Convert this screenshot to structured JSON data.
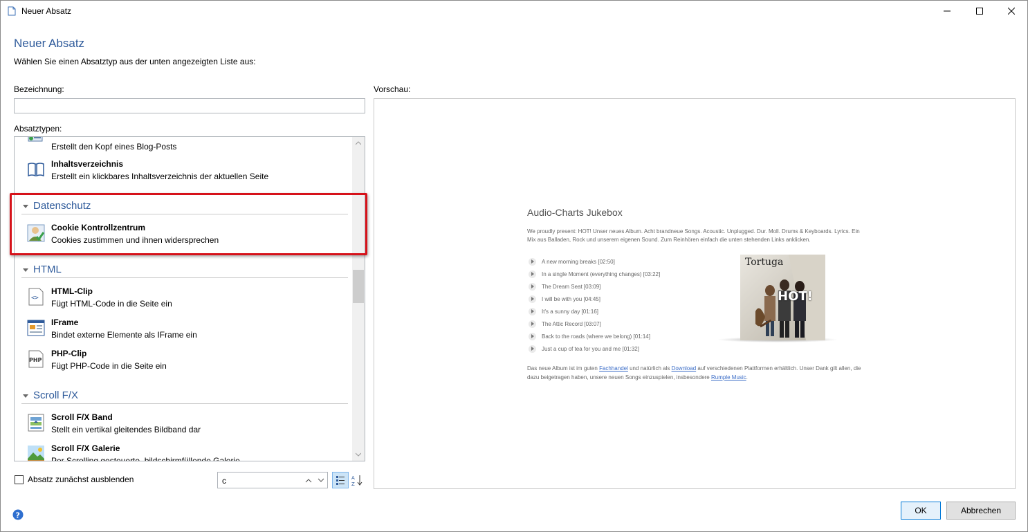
{
  "window": {
    "title": "Neuer Absatz",
    "icon": "document-icon",
    "controls": [
      "minimize",
      "maximize",
      "close"
    ]
  },
  "header": {
    "title": "Neuer Absatz",
    "subtitle": "Wählen Sie einen Absatztyp aus der unten angezeigten Liste aus:"
  },
  "form": {
    "name_label": "Bezeichnung:",
    "name_value": "",
    "types_label": "Absatztypen:",
    "preview_label": "Vorschau:"
  },
  "list": {
    "items_top": [
      {
        "name": "",
        "desc": "Erstellt den Kopf eines Blog-Posts",
        "icon": "blog-header-icon"
      },
      {
        "name": "Inhaltsverzeichnis",
        "desc": "Erstellt ein klickbares Inhaltsverzeichnis der aktuellen Seite",
        "icon": "book-icon"
      }
    ],
    "groups": [
      {
        "name": "Datenschutz",
        "items": [
          {
            "name": "Cookie Kontrollzentrum",
            "desc": "Cookies zustimmen und ihnen widersprechen",
            "icon": "user-check-icon"
          }
        ]
      },
      {
        "name": "HTML",
        "items": [
          {
            "name": "HTML-Clip",
            "desc": "Fügt HTML-Code in die Seite ein",
            "icon": "html-code-icon"
          },
          {
            "name": "IFrame",
            "desc": "Bindet externe Elemente als IFrame ein",
            "icon": "iframe-icon"
          },
          {
            "name": "PHP-Clip",
            "desc": "Fügt PHP-Code in die Seite ein",
            "icon": "php-icon"
          }
        ]
      },
      {
        "name": "Scroll F/X",
        "items": [
          {
            "name": "Scroll F/X Band",
            "desc": "Stellt ein vertikal gleitendes Bildband dar",
            "icon": "scroll-band-icon"
          },
          {
            "name": "Scroll F/X Galerie",
            "desc": "Per Scrolling gesteuerte, bildschirmfüllende Galerie",
            "icon": "landscape-icon"
          }
        ]
      }
    ]
  },
  "bottom": {
    "hide_checkbox_label": "Absatz zunächst ausblenden",
    "hide_checked": false,
    "search_value": "c"
  },
  "preview": {
    "title": "Audio-Charts Jukebox",
    "intro": "We proudly present: HOT! Unser neues Album. Acht brandneue Songs. Acoustic. Unplugged. Dur. Moll. Drums & Keyboards. Lyrics. Ein Mix aus Balladen, Rock und unserem eigenen Sound. Zum Reinhören einfach die unten stehenden Links anklicken.",
    "tracks": [
      "A new morning breaks [02:50]",
      "In a single Moment (everything changes) [03:22]",
      "The Dream Seat [03:09]",
      "I will be with you [04:45]",
      "It's a sunny day [01:16]",
      "The Attic Record [03:07]",
      "Back to the roads (where we belong) [01:14]",
      "Just a cup of tea for you and me [01:32]"
    ],
    "cover_band": "Tortuga",
    "cover_album": "HOT!",
    "outro_1": "Das neue Album ist im guten ",
    "link_1": "Fachhandel",
    "outro_2": " und natürlich als ",
    "link_2": "Download",
    "outro_3": " auf verschiedenen Plattformen erhältlich. Unser Dank gilt allen, die dazu beigetragen haben, unsere neuen Songs einzuspielen, insbesondere ",
    "link_3": "Rumple Music",
    "outro_4": "."
  },
  "buttons": {
    "ok": "OK",
    "cancel": "Abbrechen"
  },
  "colors": {
    "accent": "#2f5b9b",
    "highlight": "#d6121a",
    "primary_border": "#0078d7"
  }
}
